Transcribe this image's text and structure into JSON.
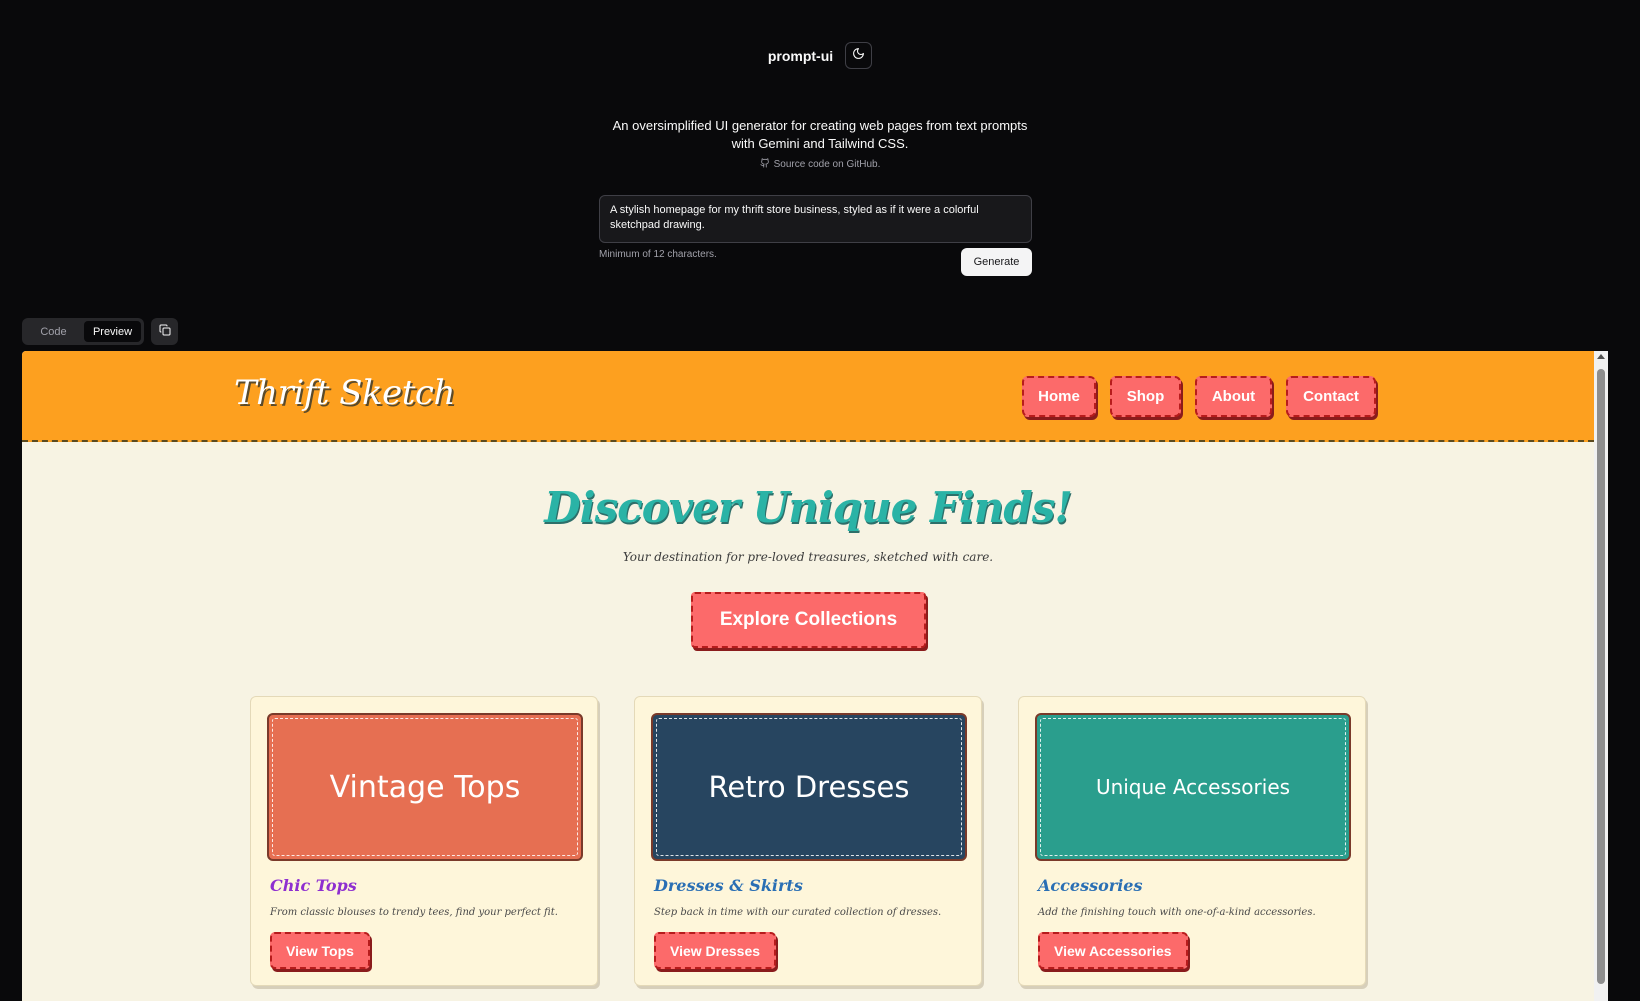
{
  "app": {
    "title": "prompt-ui",
    "theme_icon": "moon-icon",
    "tagline": "An oversimplified UI generator for creating web pages from text prompts with Gemini and Tailwind CSS.",
    "source_link": "Source code on GitHub.",
    "prompt_value": "A stylish homepage for my thrift store business, styled as if it were a colorful sketchpad drawing.",
    "hint": "Minimum of 12 characters.",
    "generate_label": "Generate",
    "view_tabs": [
      "Code",
      "Preview"
    ],
    "active_view": "Preview",
    "copy_icon": "copy-icon"
  },
  "site": {
    "logo": "Thrift Sketch",
    "nav": [
      "Home",
      "Shop",
      "About",
      "Contact"
    ],
    "hero": {
      "title": "Discover Unique Finds!",
      "subtitle": "Your destination for pre-loved treasures, sketched with care.",
      "cta": "Explore Collections"
    },
    "cards": [
      {
        "image_text": "Vintage Tops",
        "title": "Chic Tops",
        "desc": "From classic blouses to trendy tees, find your perfect fit.",
        "button": "View Tops",
        "image_color": "#e66f52",
        "title_color": "#8e2fd0"
      },
      {
        "image_text": "Retro Dresses",
        "title": "Dresses & Skirts",
        "desc": "Step back in time with our curated collection of dresses.",
        "button": "View Dresses",
        "image_color": "#274560",
        "title_color": "#2a6fb4"
      },
      {
        "image_text": "Unique Accessories",
        "title": "Accessories",
        "desc": "Add the finishing touch with one-of-a-kind accessories.",
        "button": "View Accessories",
        "image_color": "#2a9e8d",
        "title_color": "#2a6fb4"
      }
    ],
    "colors": {
      "nav_bg": "#fda01f",
      "button": "#fc6a6a",
      "hero_title": "#2ab3a6",
      "page_bg": "#f7f3e3"
    }
  }
}
